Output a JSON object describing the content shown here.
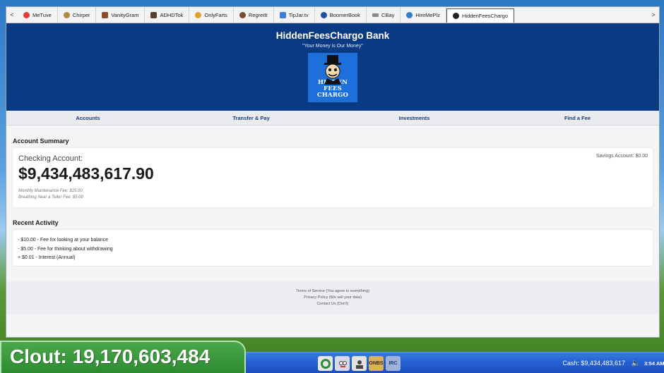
{
  "browser": {
    "left_arrow": "<",
    "right_arrow": ">",
    "tabs": [
      {
        "label": "MeTuve",
        "icon": "play-icon",
        "color": "#e53935"
      },
      {
        "label": "Chirper",
        "icon": "bird-icon",
        "color": "#b08a3e"
      },
      {
        "label": "VanityGram",
        "icon": "camera-icon",
        "color": "#8a4b2a"
      },
      {
        "label": "ADHDTok",
        "icon": "video-icon",
        "color": "#5a3d2b"
      },
      {
        "label": "OnlyFarts",
        "icon": "cloud-icon",
        "color": "#e0a030"
      },
      {
        "label": "RegretIt",
        "icon": "alien-icon",
        "color": "#7a4a33"
      },
      {
        "label": "TipJar.tv",
        "icon": "jar-icon",
        "color": "#3e7bd6"
      },
      {
        "label": "BoomerBook",
        "icon": "book-icon",
        "color": "#1e4fa0"
      },
      {
        "label": "CBay",
        "icon": "bag-icon",
        "color": "#888888"
      },
      {
        "label": "HireMePlz",
        "icon": "person-icon",
        "color": "#2f7fd0"
      },
      {
        "label": "HiddenFeesChargo",
        "icon": "tophat-icon",
        "color": "#222222"
      }
    ]
  },
  "bank": {
    "title": "HiddenFeesChargo Bank",
    "tagline": "\"Your Money is Our Money\"",
    "logo_line1": "HIDDEN FEES",
    "logo_line2": "CHARGO"
  },
  "nav": [
    "Accounts",
    "Transfer & Pay",
    "Investments",
    "Find a Fee"
  ],
  "summary": {
    "heading": "Account Summary",
    "checking_label": "Checking Account:",
    "balance": "$9,434,483,617.90",
    "fees": [
      "Monthly Maintenance Fee: $25.00",
      "Breathing Near a Teller Fee: $5.00"
    ],
    "savings": "Savings Account: $0.00"
  },
  "activity": {
    "heading": "Recent Activity",
    "items": [
      "- $10.00 - Fee for looking at your balance",
      "- $5.00 - Fee for thinking about withdrawing",
      "+ $0.01 - Interest (Annual)"
    ]
  },
  "footer": [
    "Terms of Service (You agree to everything)",
    "Privacy Policy (We sell your data)",
    "Contact Us (Don't)"
  ],
  "taskbar": {
    "clout": "Clout: 19,170,603,484",
    "cash": "Cash: $9,434,483,617",
    "clock": "3:54 AM",
    "tray_icon_labels": [
      "",
      "",
      "",
      "ONBS",
      "IRC"
    ]
  }
}
